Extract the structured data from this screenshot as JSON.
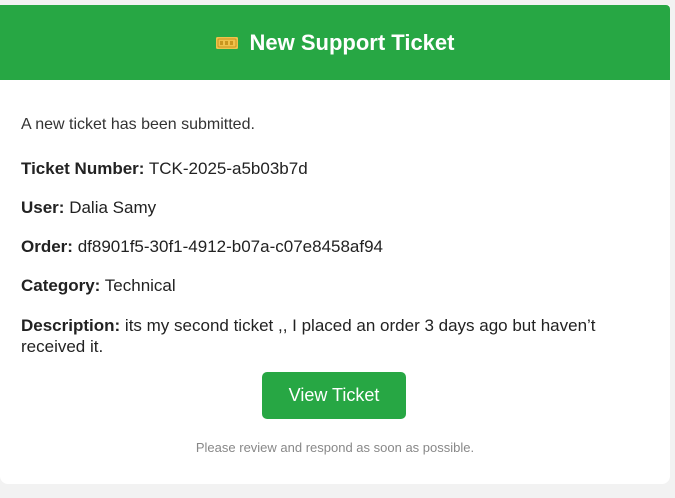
{
  "header": {
    "icon": "ticket-icon",
    "title": "New Support Ticket",
    "color": "#27a744"
  },
  "body": {
    "intro": "A new ticket has been submitted.",
    "fields": [
      {
        "label": "Ticket Number:",
        "value": "TCK-2025-a5b03b7d"
      },
      {
        "label": "User:",
        "value": "Dalia Samy"
      },
      {
        "label": "Order:",
        "value": "df8901f5-30f1-4912-b07a-c07e8458af94"
      },
      {
        "label": "Category:",
        "value": "Technical"
      },
      {
        "label": "Description:",
        "value": "its my second ticket ,, I placed an order 3 days ago but haven’t received it."
      }
    ]
  },
  "actions": {
    "view_ticket_label": "View Ticket"
  },
  "footer": {
    "note": "Please review and respond as soon as possible."
  }
}
